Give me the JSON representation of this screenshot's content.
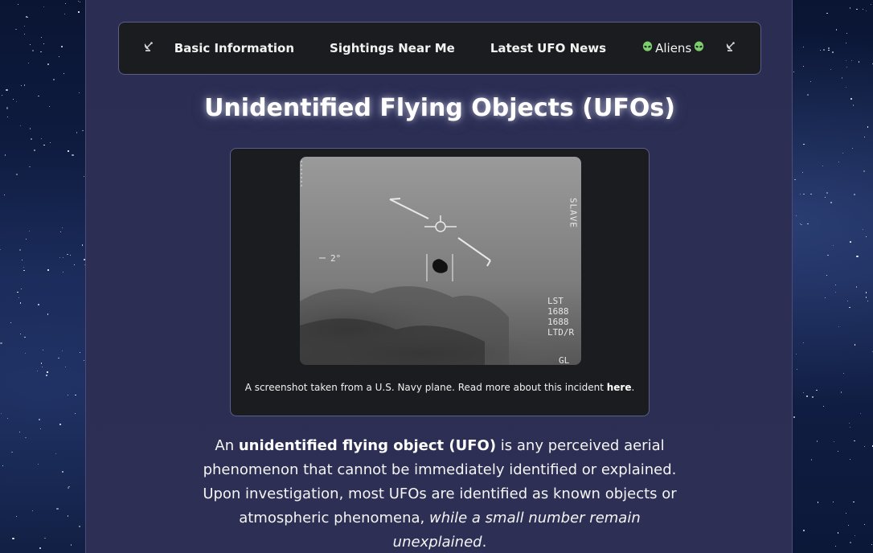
{
  "nav": {
    "left_icon": "satellite-dish-icon",
    "right_icon": "satellite-dish-icon",
    "items": [
      {
        "label": "Basic Information"
      },
      {
        "label": "Sightings Near Me"
      },
      {
        "label": "Latest UFO News"
      },
      {
        "label": "Aliens"
      }
    ]
  },
  "page": {
    "title": "Unidentified Flying Objects (UFOs)"
  },
  "figure": {
    "image_alt": "Navy infrared footage of UFO",
    "hud": {
      "angle": "2°",
      "slave": "SLAVE",
      "lines": [
        "LST",
        "1688",
        "1688",
        "LTD/R"
      ],
      "bottom": "GL"
    },
    "caption_text": "A screenshot taken from a U.S. Navy plane. Read more about this incident ",
    "caption_link": "here",
    "caption_end": "."
  },
  "intro": {
    "prefix": "An ",
    "bold_term": "unidentified flying object (UFO)",
    "middle": " is any perceived aerial phenomenon that cannot be immediately identified or explained. Upon investigation, most UFOs are identified as known objects or atmospheric phenomena, ",
    "italic_tail": "while a small number remain unexplained",
    "suffix": "."
  },
  "colors": {
    "panel": "#2b2d52",
    "card": "#1b1c1f",
    "border": "#5a5e8a",
    "alien_green": "#7ccf6a"
  }
}
